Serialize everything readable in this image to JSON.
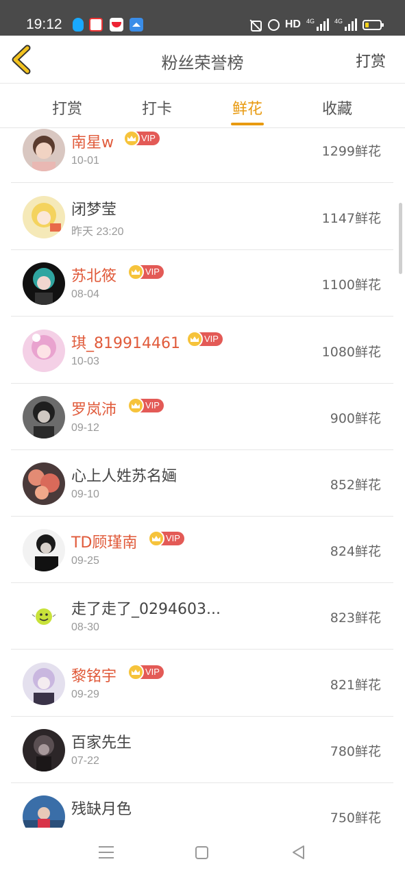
{
  "status_bar": {
    "time": "19:12",
    "hd_label": "HD",
    "signal1_label": "4G",
    "signal2_label": "4G"
  },
  "header": {
    "title": "粉丝荣誉榜",
    "action_label": "打赏"
  },
  "tabs": [
    {
      "label": "打赏",
      "active": false
    },
    {
      "label": "打卡",
      "active": false
    },
    {
      "label": "鲜花",
      "active": true
    },
    {
      "label": "收藏",
      "active": false
    }
  ],
  "vip_label": "VIP",
  "colors": {
    "accent": "#e89a10",
    "vip_name": "#e05a3a",
    "vip_badge": "#e35a56"
  },
  "fans": [
    {
      "name": "南星w",
      "date": "10-01",
      "amount": "1299鲜花",
      "vip": true
    },
    {
      "name": "闭梦莹",
      "date": "昨天 23:20",
      "amount": "1147鲜花",
      "vip": false
    },
    {
      "name": "苏北筱",
      "date": "08-04",
      "amount": "1100鲜花",
      "vip": true
    },
    {
      "name": "琪_819914461",
      "date": "10-03",
      "amount": "1080鲜花",
      "vip": true
    },
    {
      "name": "罗岚沛",
      "date": "09-12",
      "amount": "900鲜花",
      "vip": true
    },
    {
      "name": "心上人姓苏名婳",
      "date": "09-10",
      "amount": "852鲜花",
      "vip": false
    },
    {
      "name": "TD顾瑾南",
      "date": "09-25",
      "amount": "824鲜花",
      "vip": true
    },
    {
      "name": "走了走了_0294603...",
      "date": "08-30",
      "amount": "823鲜花",
      "vip": false
    },
    {
      "name": "黎铭宇",
      "date": "09-29",
      "amount": "821鲜花",
      "vip": true
    },
    {
      "name": "百家先生",
      "date": "07-22",
      "amount": "780鲜花",
      "vip": false
    },
    {
      "name": "残缺月色",
      "date": "",
      "amount": "750鲜花",
      "vip": false
    }
  ]
}
